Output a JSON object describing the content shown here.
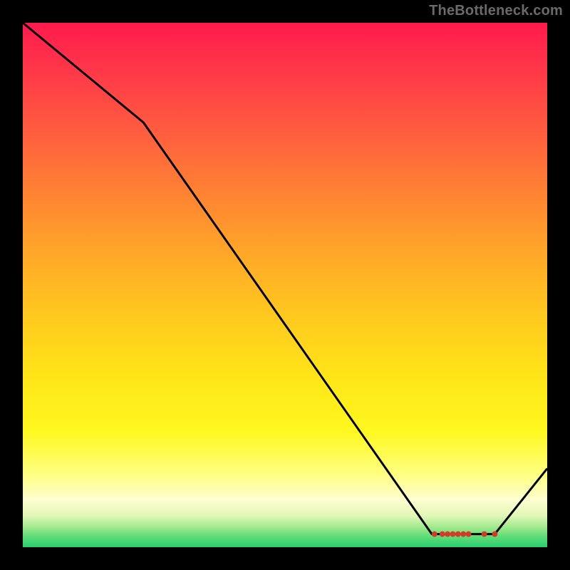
{
  "watermark": "TheBottleneck.com",
  "chart_data": {
    "type": "line",
    "title": "",
    "xlabel": "",
    "ylabel": "",
    "xlim": [
      0,
      100
    ],
    "ylim": [
      0,
      100
    ],
    "grid": false,
    "series": [
      {
        "name": "curve",
        "color": "#000000",
        "x": [
          0,
          23,
          78,
          82,
          90,
          100
        ],
        "values": [
          100,
          81,
          2.5,
          2.5,
          2.5,
          15
        ]
      }
    ],
    "markers": {
      "y": 2.5,
      "x_points": [
        78.5,
        80.0,
        81.0,
        82.0,
        83.0,
        84.0,
        85.0,
        88.0,
        90.0
      ],
      "color": "#d33a2a",
      "radius": 4
    }
  }
}
